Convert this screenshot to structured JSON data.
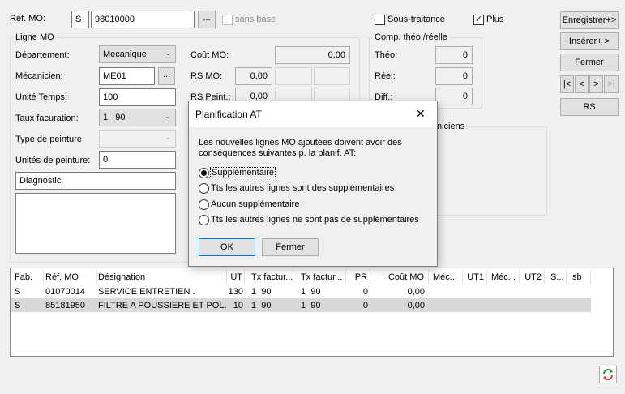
{
  "header": {
    "ref_mo_label": "Réf. MO:",
    "ref_mo_prefix": "S",
    "ref_mo_value": "98010000",
    "browse_label": "...",
    "sans_base_label": "sans base",
    "sous_traitance_label": "Sous-traitance",
    "plus_label": "Plus",
    "plus_checked_glyph": "✓"
  },
  "actions": {
    "enregistrer": "Enregistrer+>",
    "inserer": "Insérer+ >",
    "fermer": "Fermer",
    "nav_first": "|<",
    "nav_prev": "<",
    "nav_next": ">",
    "nav_last": ">|",
    "rs": "RS"
  },
  "ligne_mo": {
    "title": "Ligne MO",
    "departement_label": "Département:",
    "departement_value": "Mecanique",
    "mecanicien_label": "Mécanicien:",
    "mecanicien_value": "ME01",
    "mecanicien_browse": "...",
    "unite_temps_label": "Unité Temps:",
    "unite_temps_value": "100",
    "taux_label": "Taux facuration:",
    "taux_value": "1   90",
    "type_peinture_label": "Type de peinture:",
    "unites_peinture_label": "Unités de peinture:",
    "unites_peinture_value": "0",
    "diagnostic_value": "Diagnostic",
    "cout_mo_label": "Coût MO:",
    "cout_mo_value": "0,00",
    "rs_mo_label": "RS MO:",
    "rs_mo_value": "0,00",
    "rs_peint_label": "RS Peint.:",
    "rs_peint_value": "0,00"
  },
  "comp": {
    "title": "Comp. théo./réelle",
    "theo_label": "Théo:",
    "theo_value": "0",
    "reel_label": "Réel:",
    "reel_value": "0",
    "diff_label": "Diff.:",
    "diff_value": "0"
  },
  "mecaniciens_group_title_partial": "niciens",
  "grid": {
    "columns": [
      "Fab.",
      "Réf. MO",
      "Désignation",
      "UT",
      "Tx factur...",
      "Tx factur...",
      "PR",
      "Coût MO",
      "Méc...",
      "UT1",
      "Méc...",
      "UT2",
      "S...",
      "sb"
    ],
    "rows": [
      [
        "S",
        "01070014",
        "SERVICE ENTRETIEN .",
        "130",
        "1  90",
        "1  90",
        "0",
        "0,00",
        "",
        "",
        "",
        "",
        "",
        ""
      ],
      [
        "S",
        "85181950",
        "FILTRE A POUSSIERE ET POL...",
        "10",
        "1  90",
        "1  90",
        "0",
        "0,00",
        "",
        "",
        "",
        "",
        "",
        ""
      ]
    ]
  },
  "dialog": {
    "title": "Planification AT",
    "close_glyph": "✕",
    "message": "Les nouvelles lignes MO ajoutées doivent avoir des conséquences suivantes p. la planif. AT:",
    "options": [
      "Supplémentaire",
      "Tts les autres lignes sont des supplémentaires",
      "Aucun supplémentaire",
      "Tts les autres lignes ne sont pas de supplémentaires"
    ],
    "ok_label": "OK",
    "cancel_label": "Fermer"
  },
  "icons": {
    "refresh": "refresh-icon"
  }
}
